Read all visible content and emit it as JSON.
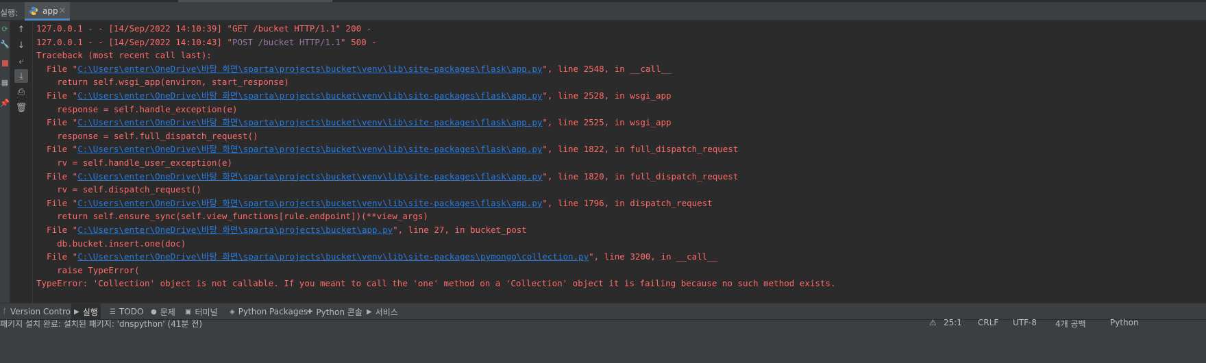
{
  "run_panel": {
    "label": "실행:",
    "tab": {
      "label": "app",
      "close": "×"
    }
  },
  "side_toolbar": {
    "left_icons": [
      "rerun-icon",
      "wrench-icon",
      "stop-icon",
      "layout-icon",
      "pin-icon"
    ],
    "buttons": [
      {
        "name": "scroll-up-icon",
        "glyph": "↑"
      },
      {
        "name": "scroll-down-icon",
        "glyph": "↓"
      },
      {
        "name": "soft-wrap-icon",
        "glyph": "⤶"
      },
      {
        "name": "scroll-to-end-icon",
        "glyph": "⤓"
      },
      {
        "name": "print-icon",
        "glyph": "⎙"
      },
      {
        "name": "trash-icon",
        "glyph": "🗑"
      }
    ]
  },
  "console": {
    "lines": [
      [
        {
          "t": "127.0.0.1 - - [14/Sep/2022 14:10:39] \"GET /bucket HTTP/1.1\" 200 -",
          "c": "red"
        }
      ],
      [
        {
          "t": "127.0.0.1 - - [14/Sep/2022 14:10:43] \"",
          "c": "red"
        },
        {
          "t": "POST /bucket HTTP/1.1",
          "c": "purple"
        },
        {
          "t": "\" 500 -",
          "c": "red"
        }
      ],
      [
        {
          "t": "Traceback (most recent call last):",
          "c": "red"
        }
      ],
      [
        {
          "t": "  File \"",
          "c": "red"
        },
        {
          "t": "C:\\Users\\enter\\OneDrive\\바탕 화면\\sparta\\projects\\bucket\\venv\\lib\\site-packages\\flask\\app.py",
          "c": "link"
        },
        {
          "t": "\", line 2548, in __call__",
          "c": "red"
        }
      ],
      [
        {
          "t": "    return self.wsgi_app(environ, start_response)",
          "c": "red"
        }
      ],
      [
        {
          "t": "  File \"",
          "c": "red"
        },
        {
          "t": "C:\\Users\\enter\\OneDrive\\바탕 화면\\sparta\\projects\\bucket\\venv\\lib\\site-packages\\flask\\app.py",
          "c": "link"
        },
        {
          "t": "\", line 2528, in wsgi_app",
          "c": "red"
        }
      ],
      [
        {
          "t": "    response = self.handle_exception(e)",
          "c": "red"
        }
      ],
      [
        {
          "t": "  File \"",
          "c": "red"
        },
        {
          "t": "C:\\Users\\enter\\OneDrive\\바탕 화면\\sparta\\projects\\bucket\\venv\\lib\\site-packages\\flask\\app.py",
          "c": "link"
        },
        {
          "t": "\", line 2525, in wsgi_app",
          "c": "red"
        }
      ],
      [
        {
          "t": "    response = self.full_dispatch_request()",
          "c": "red"
        }
      ],
      [
        {
          "t": "  File \"",
          "c": "red"
        },
        {
          "t": "C:\\Users\\enter\\OneDrive\\바탕 화면\\sparta\\projects\\bucket\\venv\\lib\\site-packages\\flask\\app.py",
          "c": "link"
        },
        {
          "t": "\", line 1822, in full_dispatch_request",
          "c": "red"
        }
      ],
      [
        {
          "t": "    rv = self.handle_user_exception(e)",
          "c": "red"
        }
      ],
      [
        {
          "t": "  File \"",
          "c": "red"
        },
        {
          "t": "C:\\Users\\enter\\OneDrive\\바탕 화면\\sparta\\projects\\bucket\\venv\\lib\\site-packages\\flask\\app.py",
          "c": "link"
        },
        {
          "t": "\", line 1820, in full_dispatch_request",
          "c": "red"
        }
      ],
      [
        {
          "t": "    rv = self.dispatch_request()",
          "c": "red"
        }
      ],
      [
        {
          "t": "  File \"",
          "c": "red"
        },
        {
          "t": "C:\\Users\\enter\\OneDrive\\바탕 화면\\sparta\\projects\\bucket\\venv\\lib\\site-packages\\flask\\app.py",
          "c": "link"
        },
        {
          "t": "\", line 1796, in dispatch_request",
          "c": "red"
        }
      ],
      [
        {
          "t": "    return self.ensure_sync(self.view_functions[rule.endpoint])(**view_args)",
          "c": "red"
        }
      ],
      [
        {
          "t": "  File \"",
          "c": "red"
        },
        {
          "t": "C:\\Users\\enter\\OneDrive\\바탕 화면\\sparta\\projects\\bucket\\app.py",
          "c": "link"
        },
        {
          "t": "\", line 27, in bucket_post",
          "c": "red"
        }
      ],
      [
        {
          "t": "    db.bucket.insert.one(doc)",
          "c": "red"
        }
      ],
      [
        {
          "t": "  File \"",
          "c": "red"
        },
        {
          "t": "C:\\Users\\enter\\OneDrive\\바탕 화면\\sparta\\projects\\bucket\\venv\\lib\\site-packages\\pymongo\\collection.py",
          "c": "link"
        },
        {
          "t": "\", line 3200, in __call__",
          "c": "red"
        }
      ],
      [
        {
          "t": "    raise TypeError(",
          "c": "red"
        }
      ],
      [
        {
          "t": "TypeError: 'Collection' object is not callable. If you meant to call the 'one' method on a 'Collection' object it is failing because no such method exists.",
          "c": "red"
        }
      ]
    ]
  },
  "bottom_tools": [
    {
      "name": "tool-version-control",
      "icon": "branch-icon",
      "glyph": "ᚴ",
      "label": "Version Control",
      "active": false
    },
    {
      "name": "tool-run",
      "icon": "run-icon",
      "glyph": "▶",
      "label": "실행",
      "active": true
    },
    {
      "name": "tool-todo",
      "icon": "list-icon",
      "glyph": "☰",
      "label": "TODO",
      "active": false
    },
    {
      "name": "tool-problems",
      "icon": "info-icon",
      "glyph": "●",
      "label": "문제",
      "active": false
    },
    {
      "name": "tool-terminal",
      "icon": "terminal-icon",
      "glyph": "▣",
      "label": "터미널",
      "active": false
    },
    {
      "name": "tool-python-packages",
      "icon": "layers-icon",
      "glyph": "◈",
      "label": "Python Packages",
      "active": false
    },
    {
      "name": "tool-python-console",
      "icon": "python-icon",
      "glyph": "✚",
      "label": "Python 콘솔",
      "active": false
    },
    {
      "name": "tool-services",
      "icon": "services-icon",
      "glyph": "▶",
      "label": "서비스",
      "active": false
    }
  ],
  "status_bar": {
    "message": "패키지 설치 완료: 설치된 패키지: 'dnspython' (41분 전)",
    "position": "25:1",
    "line_sep": "CRLF",
    "encoding": "UTF-8",
    "indent": "4개 공백",
    "interpreter": "Python"
  }
}
